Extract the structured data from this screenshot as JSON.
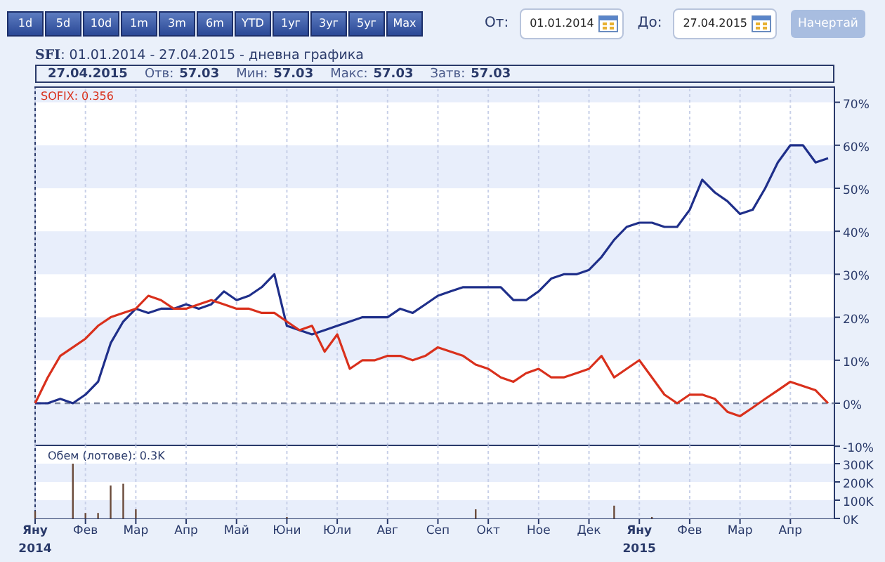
{
  "periods": [
    {
      "label": "1d",
      "selected": false
    },
    {
      "label": "5d",
      "selected": false
    },
    {
      "label": "10d",
      "selected": false
    },
    {
      "label": "1m",
      "selected": false
    },
    {
      "label": "3m",
      "selected": false
    },
    {
      "label": "6m",
      "selected": false
    },
    {
      "label": "YTD",
      "selected": false
    },
    {
      "label": "1уг",
      "selected": false
    },
    {
      "label": "3уг",
      "selected": false
    },
    {
      "label": "5уг",
      "selected": false
    },
    {
      "label": "Max",
      "selected": false
    }
  ],
  "from": {
    "label": "От:",
    "value": "01.01.2014"
  },
  "to": {
    "label": "До:",
    "value": "27.04.2015"
  },
  "draw_button": {
    "label": "Начертай",
    "disabled": true
  },
  "title": {
    "symbol": "SFI",
    "text": ": 01.01.2014 - 27.04.2015 - дневна графика"
  },
  "quote": {
    "date": "27.04.2015",
    "fields": [
      {
        "label": "Отв:",
        "value": "57.03"
      },
      {
        "label": "Мин:",
        "value": "57.03"
      },
      {
        "label": "Макс:",
        "value": "57.03"
      },
      {
        "label": "Затв:",
        "value": "57.03"
      }
    ]
  },
  "legend": "SOFIX: 0.356",
  "volume_label": "Обем (лотове): 0.3K",
  "price_chart": {
    "chart_data": {
      "type": "line",
      "ylim": [
        -10,
        73
      ],
      "grid": true,
      "ref_lines": [
        {
          "axis": "y",
          "value": 0
        }
      ],
      "categories": [
        null,
        null,
        null,
        null,
        null,
        null,
        null,
        null,
        null,
        null,
        null,
        null,
        null,
        null,
        null,
        null,
        null,
        null,
        null,
        null,
        null,
        null,
        null,
        null,
        null,
        null,
        null,
        null,
        null,
        null,
        null,
        null,
        null,
        null,
        null,
        null,
        null,
        null,
        null,
        null,
        null,
        null,
        null,
        null,
        null,
        null,
        null,
        null,
        null,
        null,
        null,
        null,
        null,
        null,
        null,
        null,
        null,
        null,
        null,
        null,
        null,
        null,
        null,
        null
      ],
      "yticks": [
        {
          "value": -10,
          "label": "-10%"
        },
        {
          "value": 0,
          "label": "0%"
        },
        {
          "value": 10,
          "label": "10%"
        },
        {
          "value": 20,
          "label": "20%"
        },
        {
          "value": 30,
          "label": "30%"
        },
        {
          "value": 40,
          "label": "40%"
        },
        {
          "value": 50,
          "label": "50%"
        },
        {
          "value": 60,
          "label": "60%"
        },
        {
          "value": 70,
          "label": "70%"
        }
      ],
      "series": [
        {
          "color": "#1f2f8a",
          "values": [
            0,
            0,
            1,
            0,
            2,
            5,
            14,
            19,
            22,
            21,
            22,
            22,
            23,
            22,
            23,
            26,
            24,
            25,
            27,
            30,
            18,
            17,
            16,
            17,
            18,
            19,
            20,
            20,
            20,
            22,
            21,
            23,
            25,
            26,
            27,
            27,
            27,
            27,
            24,
            24,
            26,
            29,
            30,
            30,
            31,
            34,
            38,
            41,
            42,
            42,
            41,
            41,
            45,
            52,
            49,
            47,
            44,
            45,
            50,
            56,
            60,
            60,
            56,
            57
          ]
        },
        {
          "color": "#d9301c",
          "values": [
            0,
            6,
            11,
            13,
            15,
            18,
            20,
            21,
            22,
            25,
            24,
            22,
            22,
            23,
            24,
            23,
            22,
            22,
            21,
            21,
            19,
            17,
            18,
            12,
            16,
            8,
            10,
            10,
            11,
            11,
            10,
            11,
            13,
            12,
            11,
            9,
            8,
            6,
            5,
            7,
            8,
            6,
            6,
            7,
            8,
            11,
            6,
            8,
            10,
            6,
            2,
            0,
            2,
            2,
            1,
            -2,
            -3,
            -1,
            1,
            3,
            5,
            4,
            3,
            0
          ]
        }
      ]
    }
  },
  "volume_chart": {
    "chart_data": {
      "type": "bar",
      "ylim": [
        0,
        400
      ],
      "grid": true,
      "categories": [
        null,
        null,
        null,
        null,
        null,
        null,
        null,
        null,
        null,
        null,
        null,
        null,
        null,
        null,
        null,
        null,
        null,
        null,
        null,
        null,
        null,
        null,
        null,
        null,
        null,
        null,
        null,
        null,
        null,
        null,
        null,
        null,
        null,
        null,
        null,
        null,
        null,
        null,
        null,
        null,
        null,
        null,
        null,
        null,
        null,
        null,
        null,
        null,
        null,
        null,
        null,
        null,
        null,
        null,
        null,
        null,
        null,
        null,
        null,
        null,
        null,
        null,
        null,
        null
      ],
      "yticks": [
        {
          "value": 0,
          "label": "0K"
        },
        {
          "value": 100,
          "label": "100K"
        },
        {
          "value": 200,
          "label": "200K"
        },
        {
          "value": 300,
          "label": "300K"
        }
      ],
      "series": [
        {
          "color": "#6a4a3a",
          "values": [
            40,
            0,
            0,
            300,
            30,
            30,
            180,
            190,
            50,
            0,
            null,
            0,
            0,
            0,
            0,
            0,
            0,
            0,
            0,
            0,
            8,
            0,
            0,
            0,
            0,
            0,
            0,
            0,
            0,
            0,
            0,
            0,
            0,
            0,
            0,
            50,
            0,
            0,
            0,
            0,
            0,
            0,
            0,
            0,
            0,
            0,
            70,
            0,
            0,
            8,
            0,
            0,
            0,
            0,
            0,
            0,
            0,
            0,
            0,
            0,
            0,
            0,
            0,
            0
          ]
        }
      ]
    }
  },
  "months": [
    "Яну",
    "Фев",
    "Мар",
    "Апр",
    "Май",
    "Юни",
    "Юли",
    "Авг",
    "Сеп",
    "Окт",
    "Ное",
    "Дек",
    "Яну",
    "Фев",
    "Мар",
    "Апр"
  ],
  "years": [
    "2014",
    "2015"
  ]
}
